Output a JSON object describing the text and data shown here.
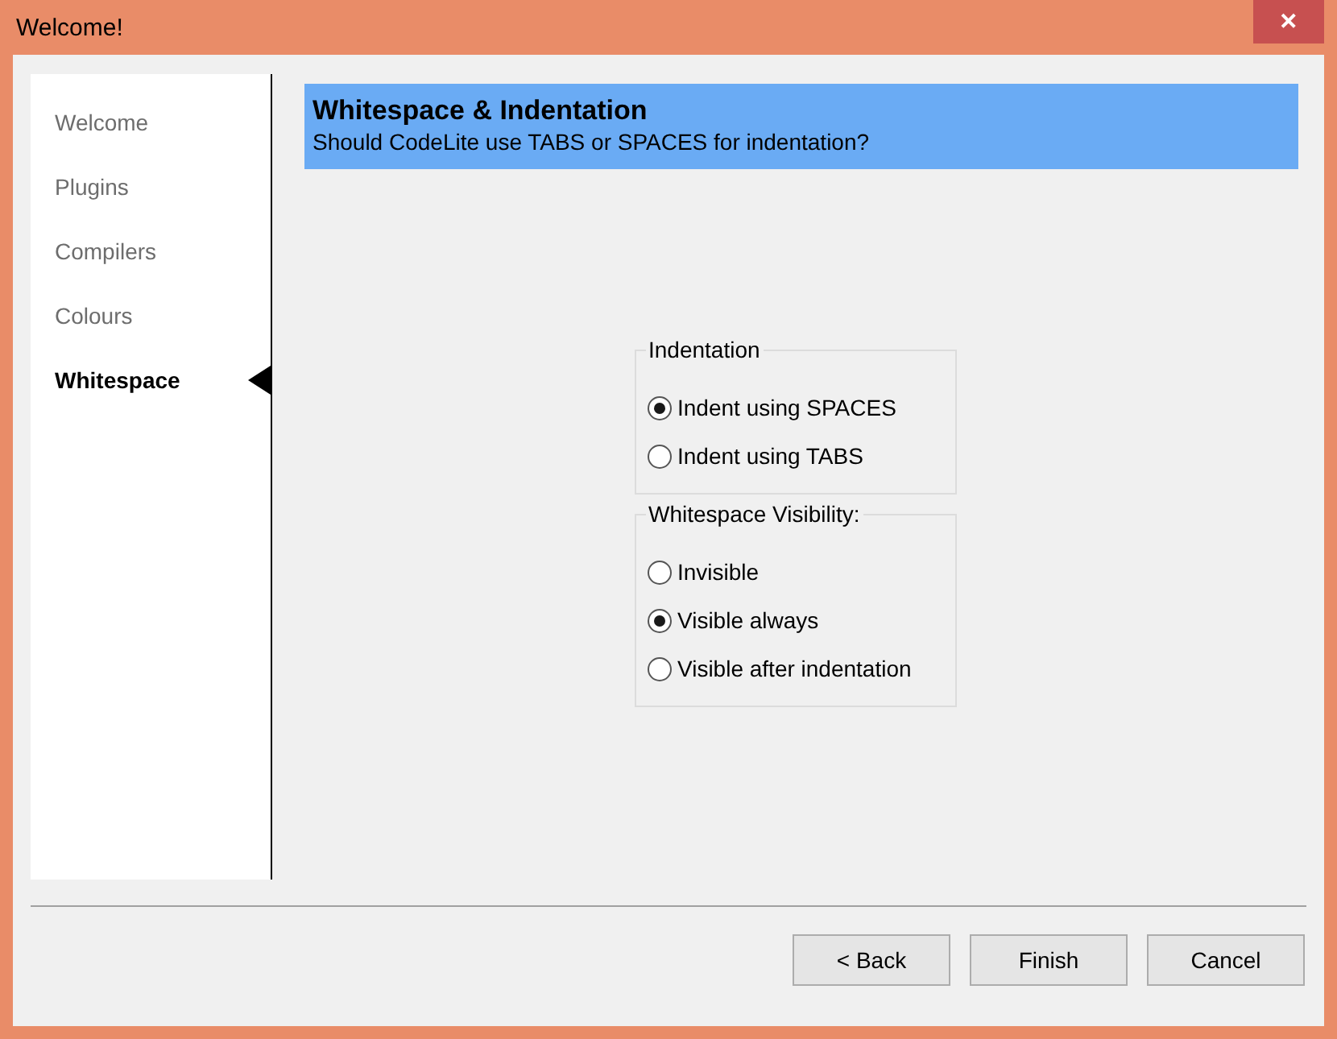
{
  "window": {
    "title": "Welcome!",
    "close": "✕"
  },
  "sidebar": {
    "items": [
      {
        "label": "Welcome",
        "selected": false
      },
      {
        "label": "Plugins",
        "selected": false
      },
      {
        "label": "Compilers",
        "selected": false
      },
      {
        "label": "Colours",
        "selected": false
      },
      {
        "label": "Whitespace",
        "selected": true
      }
    ]
  },
  "header": {
    "title": "Whitespace & Indentation",
    "subtitle": "Should CodeLite use TABS or SPACES for indentation?"
  },
  "groups": [
    {
      "title": "Indentation",
      "options": [
        {
          "label": "Indent using SPACES",
          "selected": true
        },
        {
          "label": "Indent using TABS",
          "selected": false
        }
      ]
    },
    {
      "title": "Whitespace Visibility:",
      "options": [
        {
          "label": "Invisible",
          "selected": false
        },
        {
          "label": "Visible always",
          "selected": true
        },
        {
          "label": "Visible after indentation",
          "selected": false
        }
      ]
    }
  ],
  "buttons": [
    "< Back",
    "Finish",
    "Cancel"
  ]
}
